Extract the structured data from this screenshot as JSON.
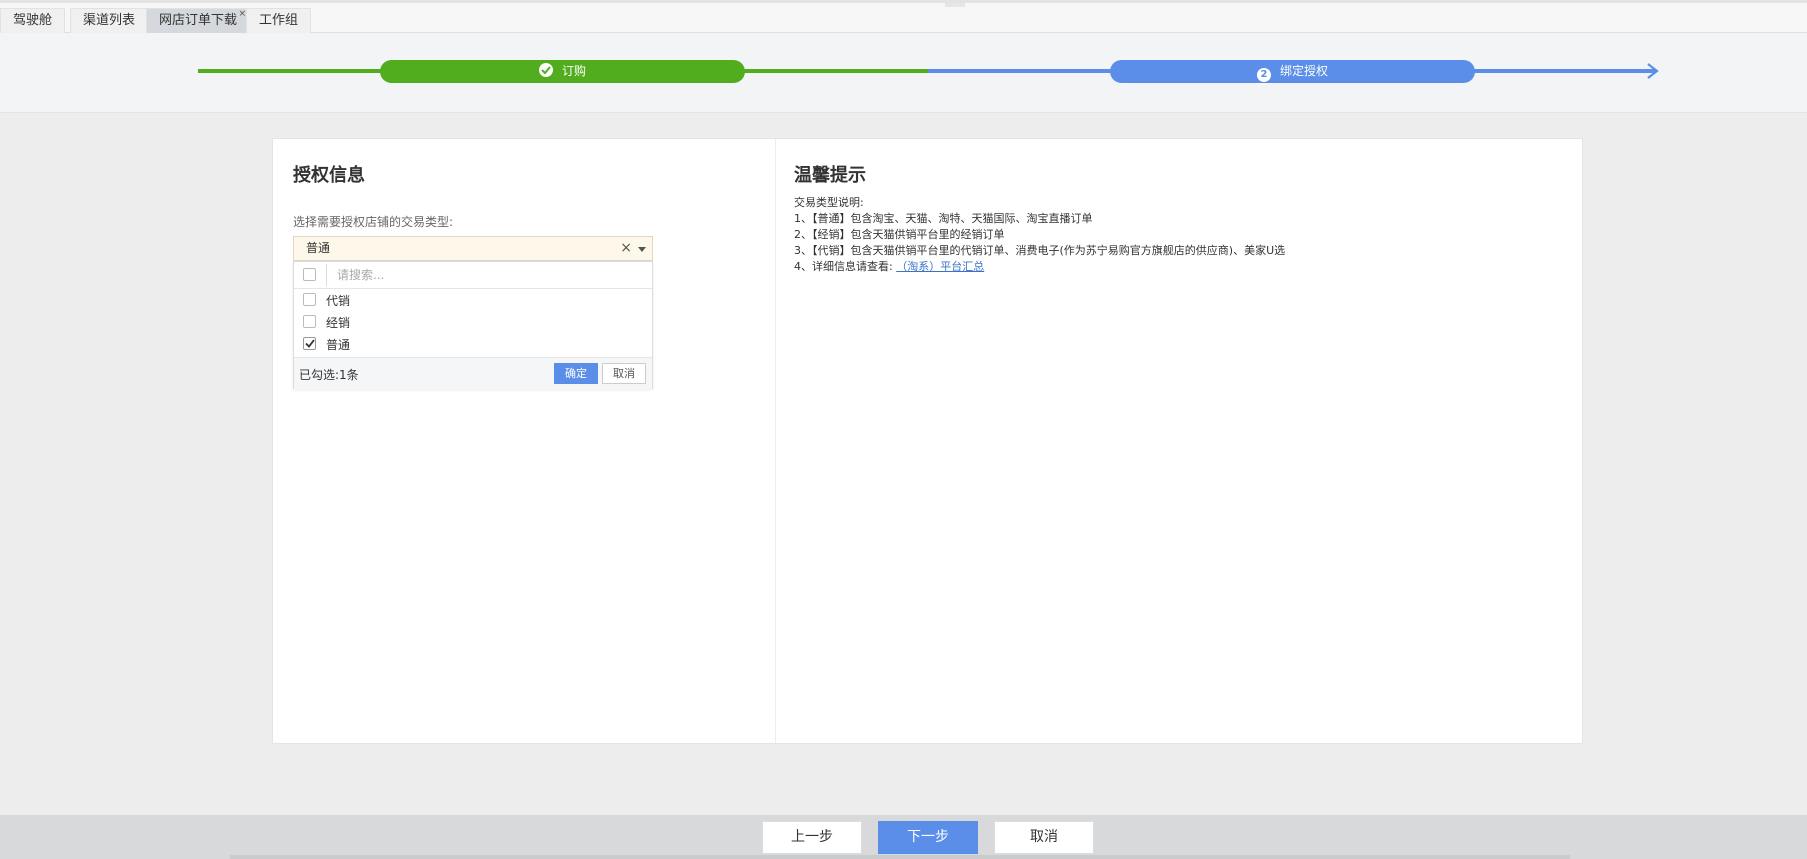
{
  "tabs": [
    {
      "label": "驾驶舱"
    },
    {
      "label": "渠道列表"
    },
    {
      "label": "网店订单下载",
      "close": "×"
    },
    {
      "label": "工作组"
    }
  ],
  "steps": [
    {
      "label": "订购",
      "status": "done"
    },
    {
      "label": "绑定授权",
      "number": "2",
      "status": "current"
    }
  ],
  "auth": {
    "title": "授权信息",
    "field_label": "选择需要授权店铺的交易类型:",
    "selected_value": "普通",
    "clear_symbol": "×",
    "search_placeholder": "请搜索...",
    "options": [
      {
        "label": "代销",
        "checked": false
      },
      {
        "label": "经销",
        "checked": false
      },
      {
        "label": "普通",
        "checked": true
      }
    ],
    "selected_count": "已勾选:1条",
    "confirm_label": "确定",
    "cancel_label": "取消"
  },
  "tips": {
    "title": "温馨提示",
    "intro": "交易类型说明:",
    "lines": [
      "1、【普通】包含淘宝、天猫、淘特、天猫国际、淘宝直播订单",
      "2、【经销】包含天猫供销平台里的经销订单",
      "3、【代销】包含天猫供销平台里的代销订单、消费电子(作为苏宁易购官方旗舰店的供应商)、美家U选"
    ],
    "link_prefix": "4、详细信息请查看:",
    "link_text": "（淘系）平台汇总"
  },
  "footer": {
    "prev_label": "上一步",
    "next_label": "下一步",
    "cancel_label": "取消"
  },
  "colors": {
    "green": "#52ad1e",
    "blue": "#5a8ee8",
    "select_bg": "#fef8ea"
  }
}
